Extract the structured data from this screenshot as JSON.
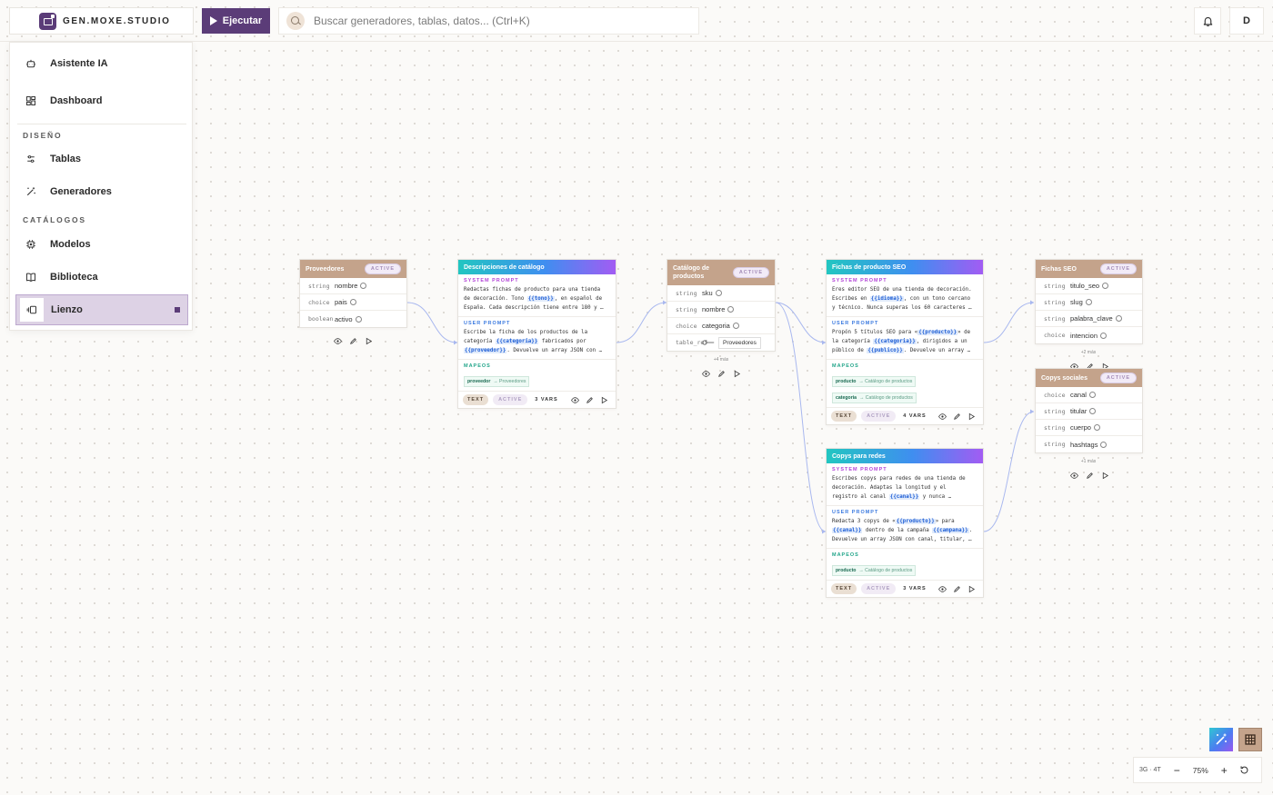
{
  "app": {
    "brand": "GEN.MOXE.STUDIO",
    "run_label": "Ejecutar",
    "avatar_initial": "D"
  },
  "search": {
    "placeholder": "Buscar generadores, tablas, datos... (Ctrl+K)"
  },
  "sidebar": {
    "items_top": [
      {
        "label": "Asistente IA",
        "icon": "bot-icon"
      },
      {
        "label": "Dashboard",
        "icon": "dashboard-icon"
      }
    ],
    "section_design": "DISEÑO",
    "items_design": [
      {
        "label": "Tablas",
        "icon": "tables-icon"
      },
      {
        "label": "Generadores",
        "icon": "wand-icon"
      }
    ],
    "section_catalogs": "CATÁLOGOS",
    "items_catalogs": [
      {
        "label": "Modelos",
        "icon": "chip-icon"
      },
      {
        "label": "Biblioteca",
        "icon": "book-icon"
      },
      {
        "label": "Lienzo",
        "icon": "canvas-icon",
        "active": true
      }
    ]
  },
  "tables": {
    "proveedores": {
      "title": "Proveedores",
      "status": "ACTIVE",
      "fields": [
        {
          "type": "string",
          "name": "nombre"
        },
        {
          "type": "choice",
          "name": "pais"
        },
        {
          "type": "boolean",
          "name": "activo"
        }
      ]
    },
    "catalogo": {
      "title": "Catálogo de productos",
      "status": "ACTIVE",
      "fields": [
        {
          "type": "string",
          "name": "sku"
        },
        {
          "type": "string",
          "name": "nombre"
        },
        {
          "type": "choice",
          "name": "categoria"
        },
        {
          "type": "table_ref",
          "name": "",
          "ref": "Proveedores"
        }
      ],
      "more": "+4 más"
    },
    "fichas_seo": {
      "title": "Fichas SEO",
      "status": "ACTIVE",
      "fields": [
        {
          "type": "string",
          "name": "titulo_seo"
        },
        {
          "type": "string",
          "name": "slug"
        },
        {
          "type": "string",
          "name": "palabra_clave"
        },
        {
          "type": "choice",
          "name": "intencion"
        }
      ],
      "more": "+2 más"
    },
    "copys_sociales": {
      "title": "Copys sociales",
      "status": "ACTIVE",
      "fields": [
        {
          "type": "choice",
          "name": "canal"
        },
        {
          "type": "string",
          "name": "titular"
        },
        {
          "type": "string",
          "name": "cuerpo"
        },
        {
          "type": "string",
          "name": "hashtags"
        }
      ],
      "more": "+1 más"
    }
  },
  "generators": {
    "descripciones": {
      "title": "Descripciones de catálogo",
      "system_label": "SYSTEM PROMPT",
      "system_lines": [
        [
          {
            "t": "Redactas fichas de producto para una tienda"
          }
        ],
        [
          {
            "t": "de decoración. Tono "
          },
          {
            "v": "{{tono}}"
          },
          {
            "t": ", en español de"
          }
        ],
        [
          {
            "t": "España. Cada descripción tiene entre 180 y …"
          }
        ]
      ],
      "user_label": "USER PROMPT",
      "user_lines": [
        [
          {
            "t": "Escribe la ficha de los productos de la"
          }
        ],
        [
          {
            "t": "categoría "
          },
          {
            "v": "{{categoria}}"
          },
          {
            "t": " fabricados por"
          }
        ],
        [
          {
            "v": "{{proveedor}}"
          },
          {
            "t": ". Devuelve un array JSON con …"
          }
        ]
      ],
      "map_label": "MAPEOS",
      "mappings": [
        {
          "key": "proveedor",
          "table": "Proveedores"
        }
      ],
      "type": "TEXT",
      "status": "ACTIVE",
      "vars": "3 VARS"
    },
    "fichas_producto": {
      "title": "Fichas de producto SEO",
      "system_label": "SYSTEM PROMPT",
      "system_lines": [
        [
          {
            "t": "Eres editor SEO de una tienda de decoración."
          }
        ],
        [
          {
            "t": "Escribes en "
          },
          {
            "v": "{{idioma}}"
          },
          {
            "t": ", con un tono cercano"
          }
        ],
        [
          {
            "t": "y técnico. Nunca superas los 60 caracteres …"
          }
        ]
      ],
      "user_label": "USER PROMPT",
      "user_lines": [
        [
          {
            "t": "Propón 5 títulos SEO para «"
          },
          {
            "v": "{{producto}}"
          },
          {
            "t": "» de"
          }
        ],
        [
          {
            "t": "la categoría "
          },
          {
            "v": "{{categoria}}"
          },
          {
            "t": ", dirigidos a un"
          }
        ],
        [
          {
            "t": "público de "
          },
          {
            "v": "{{publico}}"
          },
          {
            "t": ". Devuelve un array …"
          }
        ]
      ],
      "map_label": "MAPEOS",
      "mappings": [
        {
          "key": "producto",
          "table": "Catálogo de productos"
        },
        {
          "key": "categoria",
          "table": "Catálogo de productos"
        }
      ],
      "type": "TEXT",
      "status": "ACTIVE",
      "vars": "4 VARS"
    },
    "copys_redes": {
      "title": "Copys para redes",
      "system_label": "SYSTEM PROMPT",
      "system_lines": [
        [
          {
            "t": "Escribes copys para redes de una tienda de"
          }
        ],
        [
          {
            "t": "decoración. Adaptas la longitud y el"
          }
        ],
        [
          {
            "t": "registro al canal "
          },
          {
            "v": "{{canal}}"
          },
          {
            "t": " y nunca …"
          }
        ]
      ],
      "user_label": "USER PROMPT",
      "user_lines": [
        [
          {
            "t": "Redacta 3 copys de «"
          },
          {
            "v": "{{producto}}"
          },
          {
            "t": "» para"
          }
        ],
        [
          {
            "v": "{{canal}}"
          },
          {
            "t": " dentro de la campaña "
          },
          {
            "v": "{{campana}}"
          },
          {
            "t": "."
          }
        ],
        [
          {
            "t": "Devuelve un array JSON con canal, titular, …"
          }
        ]
      ],
      "map_label": "MAPEOS",
      "mappings": [
        {
          "key": "producto",
          "table": "Catálogo de productos"
        }
      ],
      "type": "TEXT",
      "status": "ACTIVE",
      "vars": "3 VARS"
    }
  },
  "canvas": {
    "counts": "3G · 4T",
    "zoom": "75%"
  },
  "colors": {
    "brand": "#5b3c78",
    "table_header": "#c4a38b",
    "edge": "#a9b8ef"
  }
}
